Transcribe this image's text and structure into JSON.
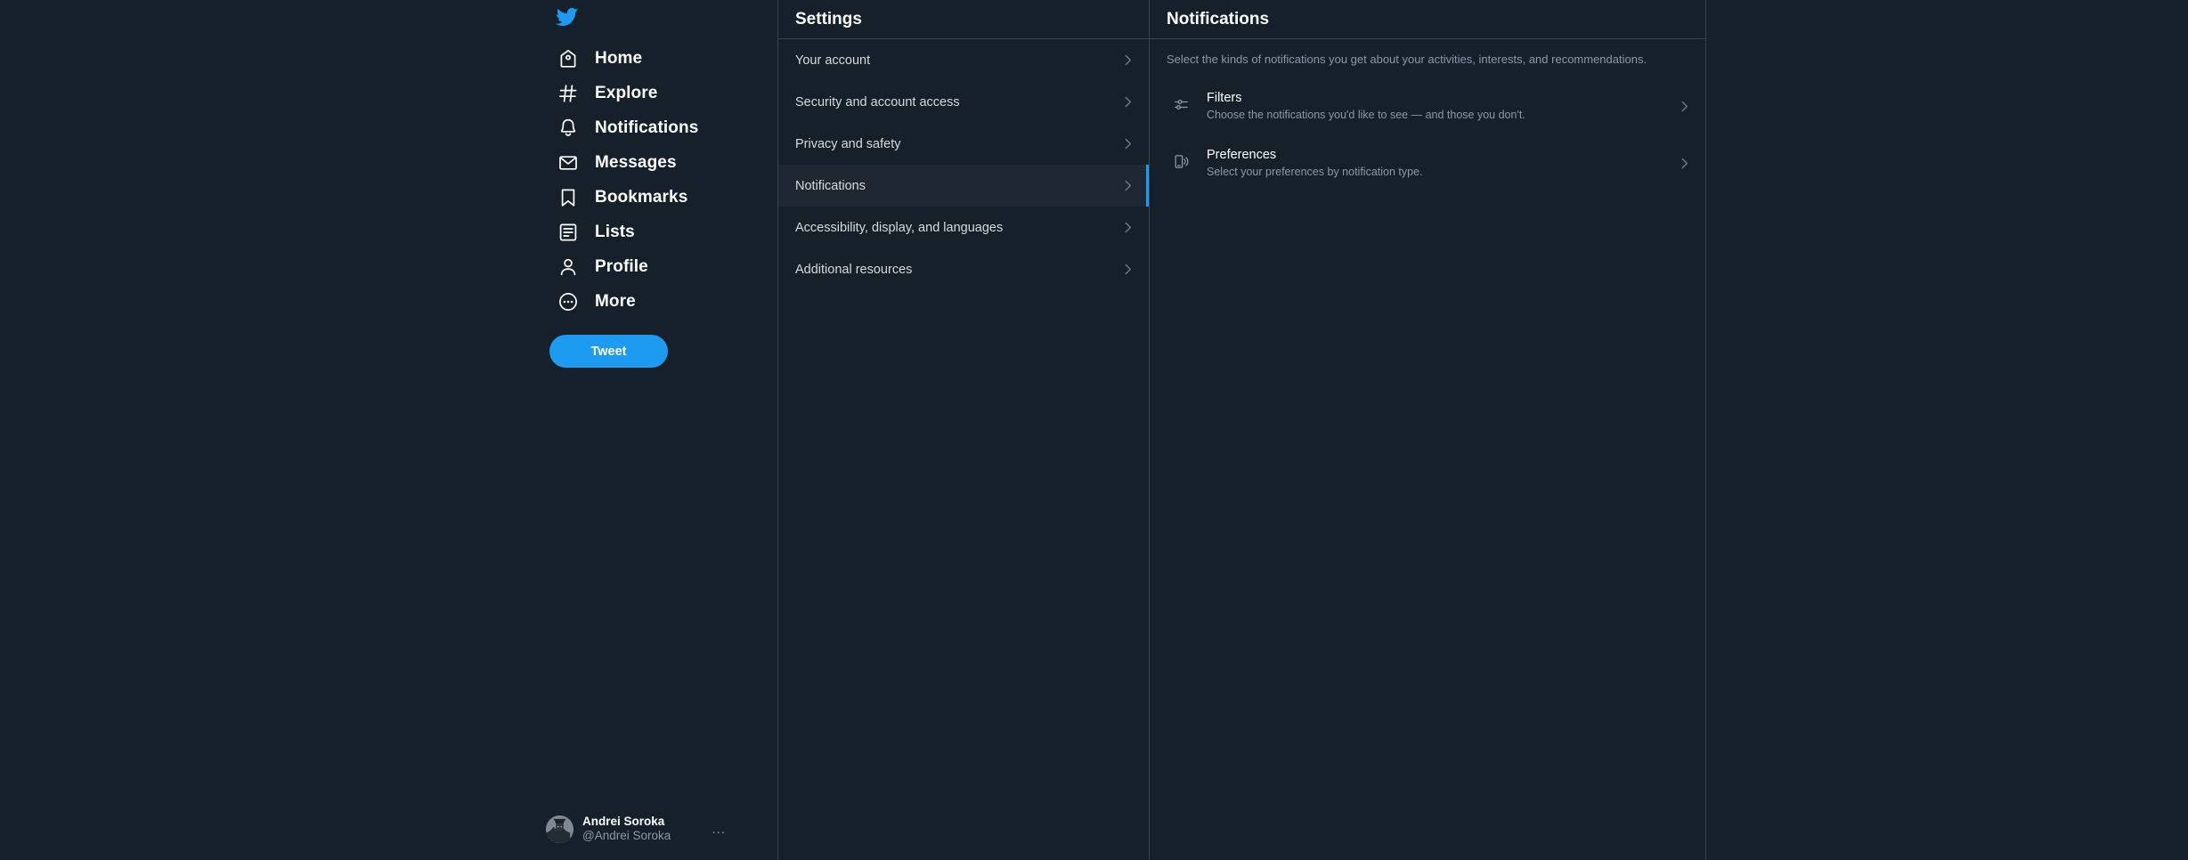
{
  "brand": {
    "logo_icon": "twitter-bird-icon",
    "accent_color": "#1d9bf0",
    "background_color": "#15202b",
    "border_color": "#38444d",
    "selected_row_color": "#1e2732",
    "muted_text_color": "#8b98a5"
  },
  "sidebar": {
    "items": [
      {
        "label": "Home",
        "icon": "home-icon"
      },
      {
        "label": "Explore",
        "icon": "hashtag-icon"
      },
      {
        "label": "Notifications",
        "icon": "bell-icon"
      },
      {
        "label": "Messages",
        "icon": "envelope-icon"
      },
      {
        "label": "Bookmarks",
        "icon": "bookmark-icon"
      },
      {
        "label": "Lists",
        "icon": "list-icon"
      },
      {
        "label": "Profile",
        "icon": "person-icon"
      },
      {
        "label": "More",
        "icon": "more-circle-icon"
      }
    ],
    "tweet_button": "Tweet",
    "account": {
      "name": "Andrei Soroka",
      "handle": "@Andrei Soroka",
      "avatar_icon": "batman-avatar",
      "overflow_icon": "ellipsis-icon",
      "overflow_label": "..."
    }
  },
  "settings": {
    "header": "Settings",
    "rows": [
      {
        "label": "Your account",
        "selected": false,
        "chevron": "chevron-right-icon"
      },
      {
        "label": "Security and account access",
        "selected": false,
        "chevron": "chevron-right-icon"
      },
      {
        "label": "Privacy and safety",
        "selected": false,
        "chevron": "chevron-right-icon"
      },
      {
        "label": "Notifications",
        "selected": true,
        "chevron": "chevron-right-icon"
      },
      {
        "label": "Accessibility, display, and languages",
        "selected": false,
        "chevron": "chevron-right-icon"
      },
      {
        "label": "Additional resources",
        "selected": false,
        "chevron": "chevron-right-icon"
      }
    ]
  },
  "detail": {
    "header": "Notifications",
    "description": "Select the kinds of notifications you get about your activities, interests, and recommendations.",
    "rows": [
      {
        "title": "Filters",
        "subtitle": "Choose the notifications you'd like to see — and those you don't.",
        "icon": "sliders-icon",
        "chevron": "chevron-right-icon"
      },
      {
        "title": "Preferences",
        "subtitle": "Select your preferences by notification type.",
        "icon": "device-signal-icon",
        "chevron": "chevron-right-icon"
      }
    ]
  }
}
